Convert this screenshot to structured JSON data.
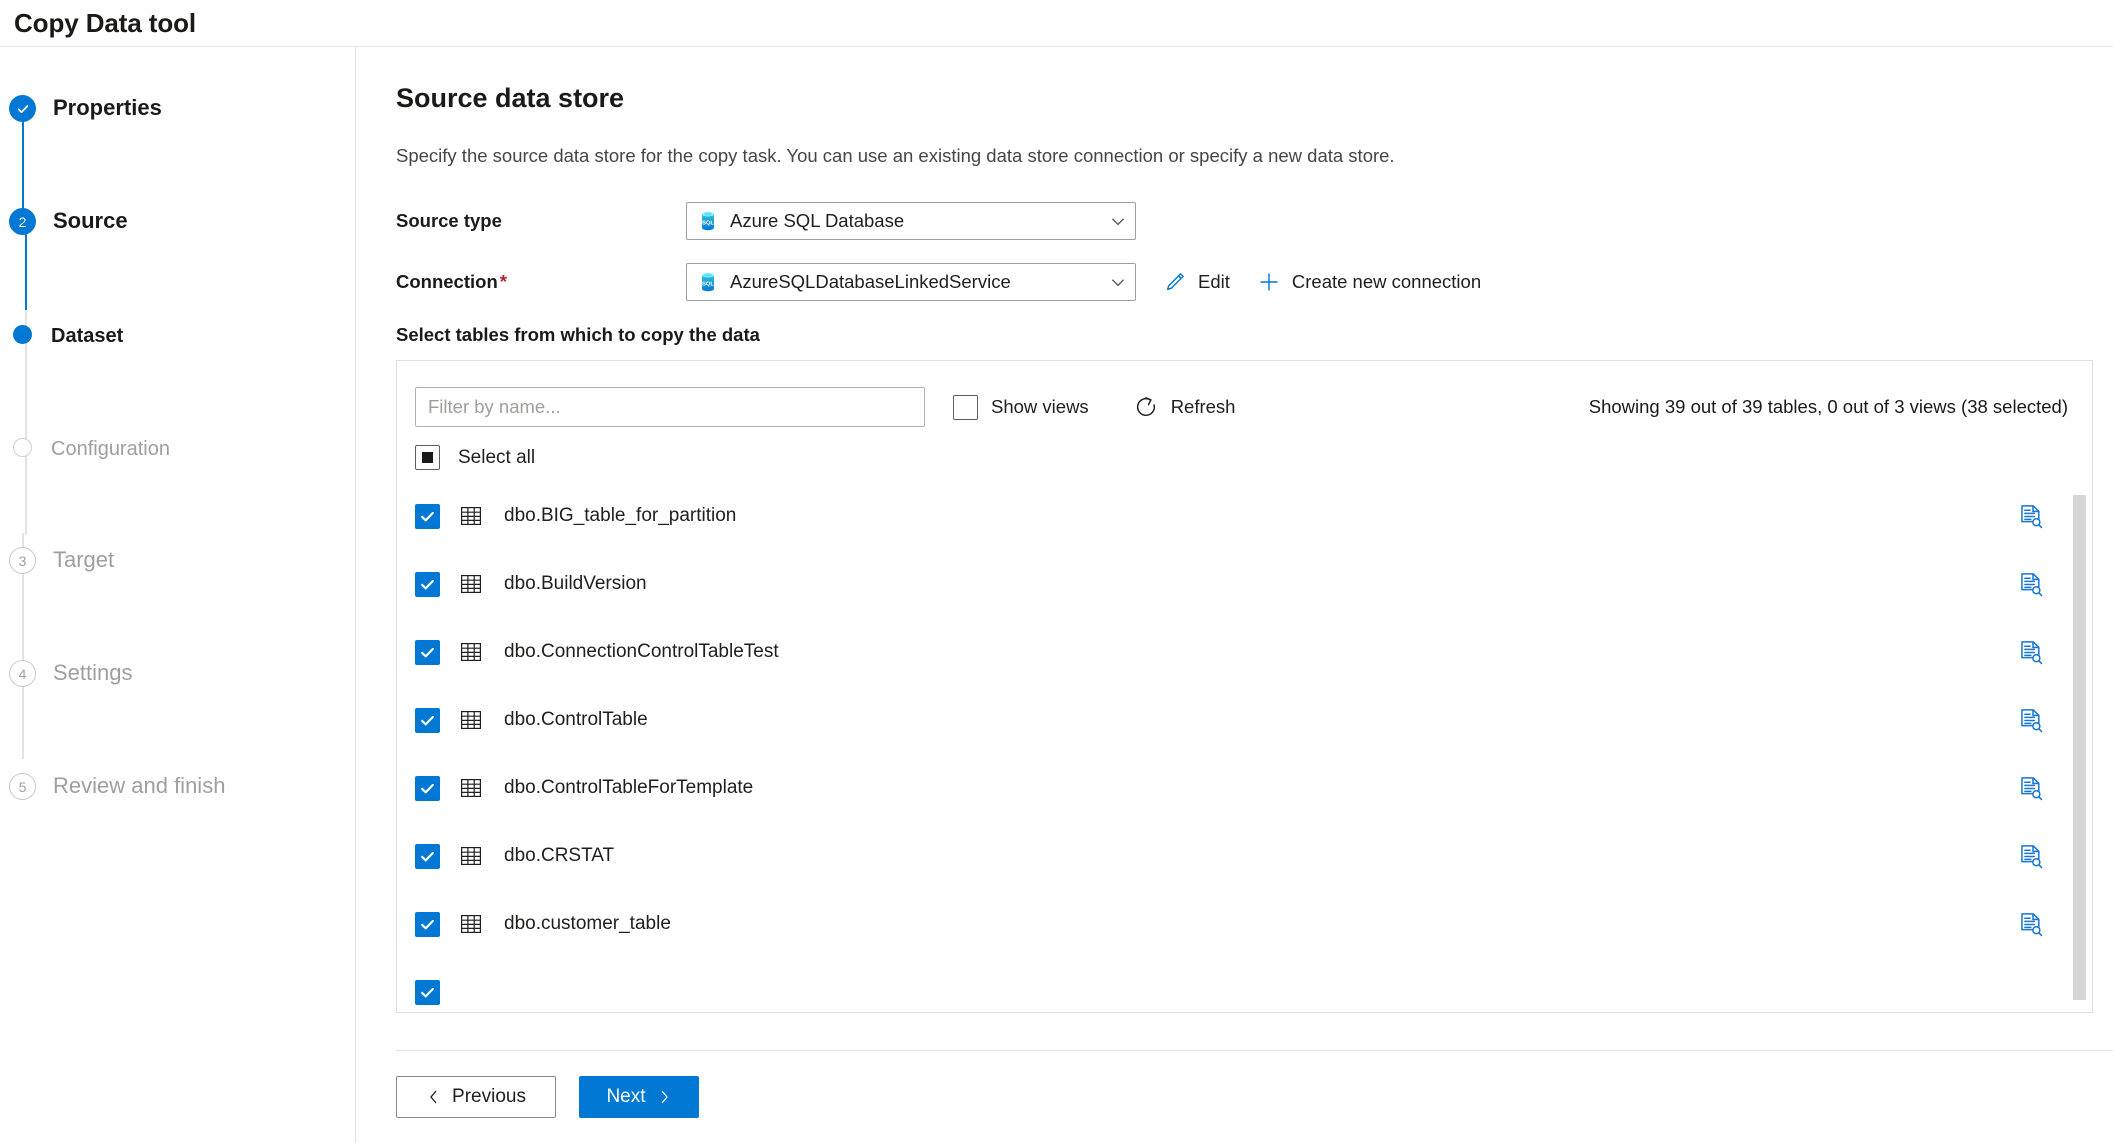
{
  "window": {
    "title": "Copy Data tool"
  },
  "wizard": {
    "steps": [
      {
        "id": "properties",
        "label": "Properties",
        "marker": "check",
        "state": "complete"
      },
      {
        "id": "source",
        "label": "Source",
        "marker": "2",
        "state": "current"
      },
      {
        "id": "dataset",
        "label": "Dataset",
        "marker": "dot",
        "state": "current-sub"
      },
      {
        "id": "configuration",
        "label": "Configuration",
        "marker": "circle",
        "state": "pending-sub"
      },
      {
        "id": "target",
        "label": "Target",
        "marker": "3",
        "state": "pending"
      },
      {
        "id": "settings",
        "label": "Settings",
        "marker": "4",
        "state": "pending"
      },
      {
        "id": "review",
        "label": "Review and finish",
        "marker": "5",
        "state": "pending"
      }
    ]
  },
  "main": {
    "title": "Source data store",
    "description": "Specify the source data store for the copy task. You can use an existing data store connection or specify a new data store.",
    "source_type": {
      "label": "Source type",
      "value": "Azure SQL Database",
      "icon": "azure-sql-database-icon"
    },
    "connection": {
      "label": "Connection",
      "required_marker": "*",
      "value": "AzureSQLDatabaseLinkedService",
      "icon": "azure-sql-database-icon",
      "edit_label": "Edit",
      "create_label": "Create new connection"
    },
    "tables_section": {
      "heading": "Select tables from which to copy the data",
      "filter_placeholder": "Filter by name...",
      "filter_value": "",
      "show_views_label": "Show views",
      "show_views_checked": false,
      "refresh_label": "Refresh",
      "status": "Showing 39 out of 39 tables, 0 out of 3 views (38 selected)",
      "select_all_label": "Select all",
      "select_all_state": "indeterminate",
      "rows": [
        {
          "name": "dbo.BIG_table_for_partition",
          "checked": true
        },
        {
          "name": "dbo.BuildVersion",
          "checked": true
        },
        {
          "name": "dbo.ConnectionControlTableTest",
          "checked": true
        },
        {
          "name": "dbo.ControlTable",
          "checked": true
        },
        {
          "name": "dbo.ControlTableForTemplate",
          "checked": true
        },
        {
          "name": "dbo.CRSTAT",
          "checked": true
        },
        {
          "name": "dbo.customer_table",
          "checked": true
        }
      ]
    }
  },
  "footer": {
    "previous_label": "Previous",
    "next_label": "Next"
  },
  "colors": {
    "accent": "#0078d4",
    "required": "#a4262c",
    "muted_text": "#a19f9d",
    "border": "#e1dfdd"
  }
}
